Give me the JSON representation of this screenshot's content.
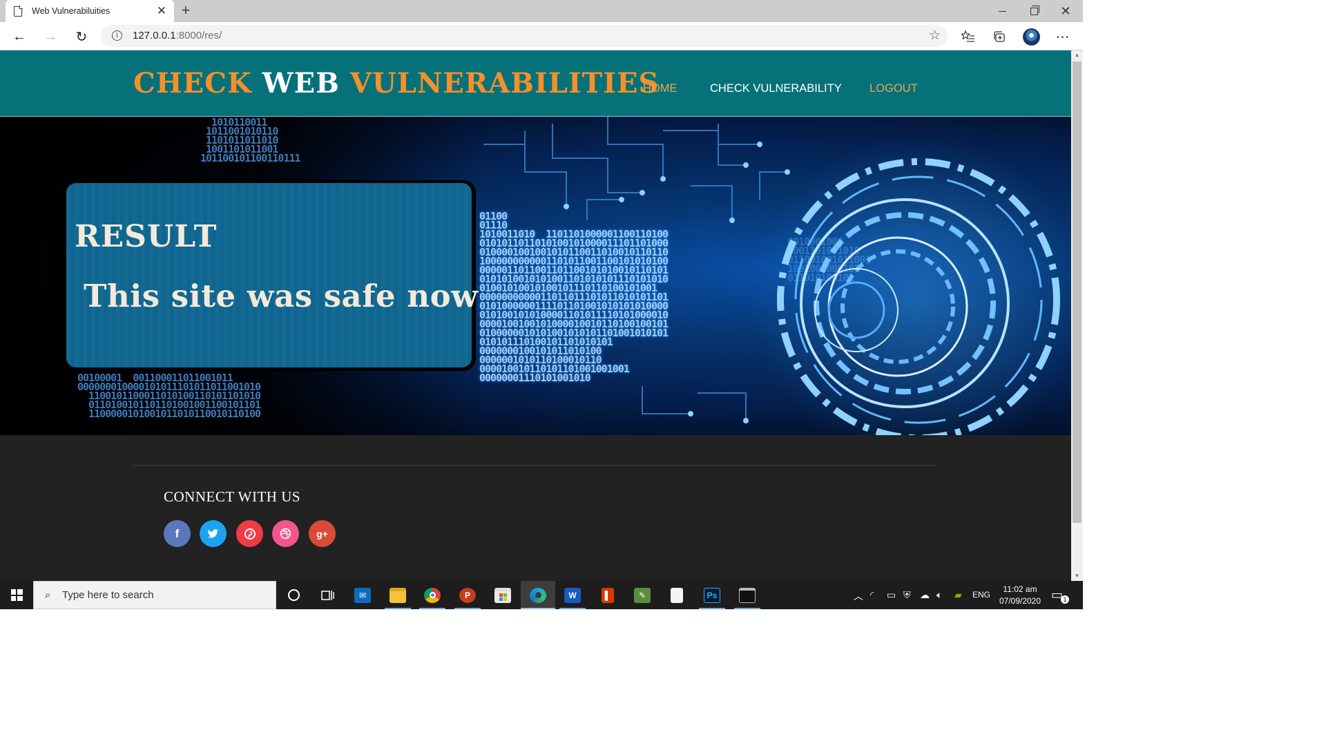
{
  "browser": {
    "tab_title": "Web Vulnerabiluities",
    "tab_close": "✕",
    "new_tab": "+",
    "url_host": "127.0.0.1",
    "url_rest": ":8000/res/"
  },
  "site": {
    "brand": {
      "part1": "CHECK ",
      "part2": "WEB ",
      "part3": "VULNERABILITIES"
    },
    "nav": {
      "home": "HOME",
      "check": "CHECK VULNERABILITY",
      "logout": "LOGOUT"
    },
    "colors": {
      "header_bg": "#07717a",
      "brand_orange": "#f5902a",
      "nav_accent": "#e9a94e",
      "card_bg": "#0d6590",
      "footer_bg": "#222222"
    }
  },
  "result": {
    "title": "RESULT",
    "message": "This site was safe now"
  },
  "footer": {
    "connect_label": "CONNECT WITH US",
    "social": [
      {
        "icon": "facebook-icon",
        "glyph": "f"
      },
      {
        "icon": "twitter-icon",
        "glyph": "🐦"
      },
      {
        "icon": "pinterest-icon",
        "glyph": "p"
      },
      {
        "icon": "dribbble-icon",
        "glyph": "⊕"
      },
      {
        "icon": "google-plus-icon",
        "glyph": "g+"
      }
    ]
  },
  "taskbar": {
    "search_placeholder": "Type here to search",
    "language": "ENG",
    "time": "11:02 am",
    "date": "07/09/2020",
    "notification_count": "1"
  }
}
